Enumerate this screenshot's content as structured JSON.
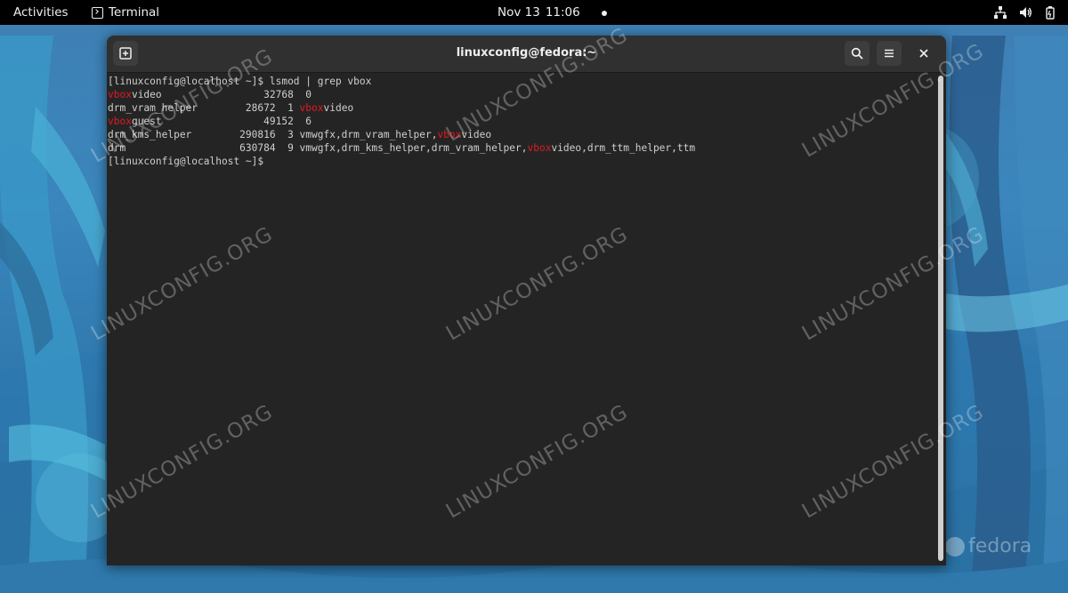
{
  "topbar": {
    "activities_label": "Activities",
    "app_name": "Terminal",
    "app_icon": "terminal-icon",
    "date": "Nov 13",
    "time": "11:06",
    "tray_icons": [
      "network-icon",
      "volume-icon",
      "battery-icon"
    ]
  },
  "terminal": {
    "title": "linuxconfig@fedora:~",
    "buttons": {
      "new_tab_icon": "new-tab-icon",
      "search_icon": "search-icon",
      "menu_icon": "hamburger-menu-icon",
      "close_icon": "close-icon"
    },
    "highlight_color": "#e01b24",
    "lines": [
      [
        {
          "text": "[linuxconfig@localhost ~]$ lsmod | grep vbox"
        }
      ],
      [
        {
          "text": "vbox",
          "hl": true
        },
        {
          "text": "video                 32768  0"
        }
      ],
      [
        {
          "text": "drm_vram_helper        28672  1 "
        },
        {
          "text": "vbox",
          "hl": true
        },
        {
          "text": "video"
        }
      ],
      [
        {
          "text": "vbox",
          "hl": true
        },
        {
          "text": "guest                 49152  6"
        }
      ],
      [
        {
          "text": "drm_kms_helper        290816  3 vmwgfx,drm_vram_helper,"
        },
        {
          "text": "vbox",
          "hl": true
        },
        {
          "text": "video"
        }
      ],
      [
        {
          "text": "drm                   630784  9 vmwgfx,drm_kms_helper,drm_vram_helper,"
        },
        {
          "text": "vbox",
          "hl": true
        },
        {
          "text": "video,drm_ttm_helper,ttm"
        }
      ],
      [
        {
          "text": "[linuxconfig@localhost ~]$ "
        }
      ]
    ]
  },
  "watermark": {
    "text": "LINUXCONFIG.ORG"
  },
  "wallpaper": {
    "logo_text": "fedora"
  }
}
